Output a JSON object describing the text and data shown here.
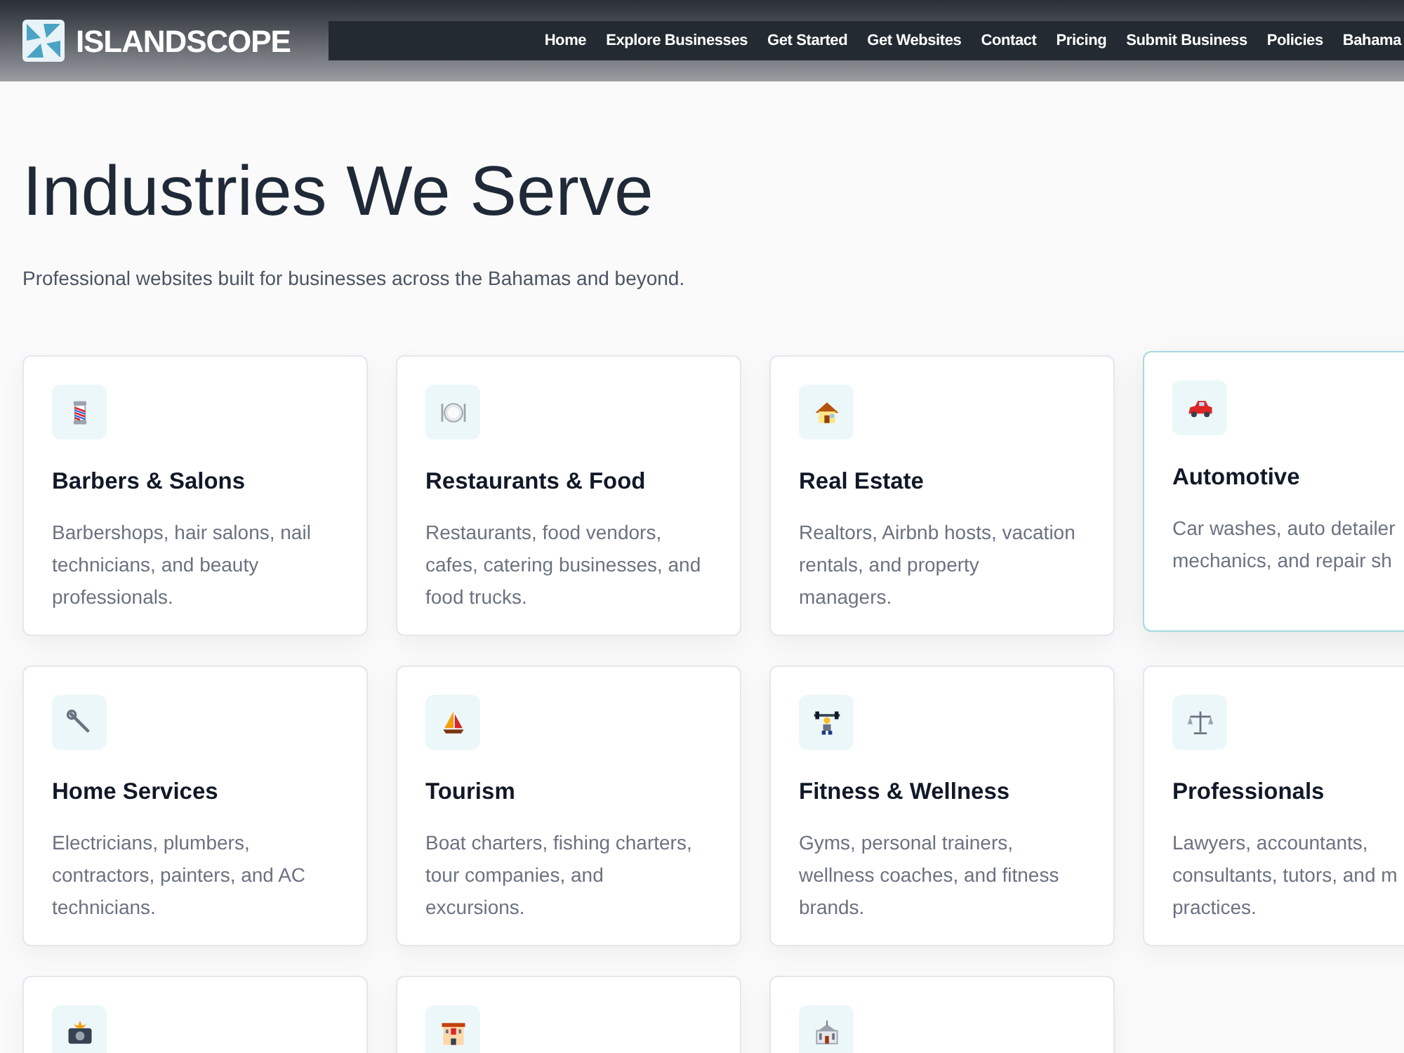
{
  "header": {
    "logo_text": "ISLANDSCOPE",
    "nav": [
      "Home",
      "Explore Businesses",
      "Get Started",
      "Get Websites",
      "Contact",
      "Pricing",
      "Submit Business",
      "Policies",
      "Bahama"
    ]
  },
  "title": "Industries We Serve",
  "subtitle": "Professional websites built for businesses across the Bahamas and beyond.",
  "cards": [
    {
      "title": "Barbers & Salons",
      "lines": [
        "Barbershops, hair salons, nail",
        "technicians, and beauty",
        "professionals."
      ],
      "highlighted": false
    },
    {
      "title": "Restaurants & Food",
      "lines": [
        "Restaurants, food vendors,",
        "cafes, catering businesses, and",
        "food trucks."
      ],
      "highlighted": false
    },
    {
      "title": "Real Estate",
      "lines": [
        "Realtors, Airbnb hosts, vacation",
        "rentals, and property",
        "managers."
      ],
      "highlighted": false
    },
    {
      "title": "Automotive",
      "lines": [
        "Car washes, auto detailer",
        "mechanics, and repair sh"
      ],
      "highlighted": true
    },
    {
      "title": "Home Services",
      "lines": [
        "Electricians, plumbers,",
        "contractors, painters, and AC",
        "technicians."
      ],
      "highlighted": false
    },
    {
      "title": "Tourism",
      "lines": [
        "Boat charters, fishing charters,",
        "tour companies, and",
        "excursions."
      ],
      "highlighted": false
    },
    {
      "title": "Fitness & Wellness",
      "lines": [
        "Gyms, personal trainers,",
        "wellness coaches, and fitness",
        "brands."
      ],
      "highlighted": false
    },
    {
      "title": "Professionals",
      "lines": [
        "Lawyers, accountants,",
        "consultants, tutors, and m",
        "practices."
      ],
      "highlighted": false
    },
    {
      "highlighted": false
    },
    {
      "highlighted": false
    },
    {
      "highlighted": false
    }
  ]
}
